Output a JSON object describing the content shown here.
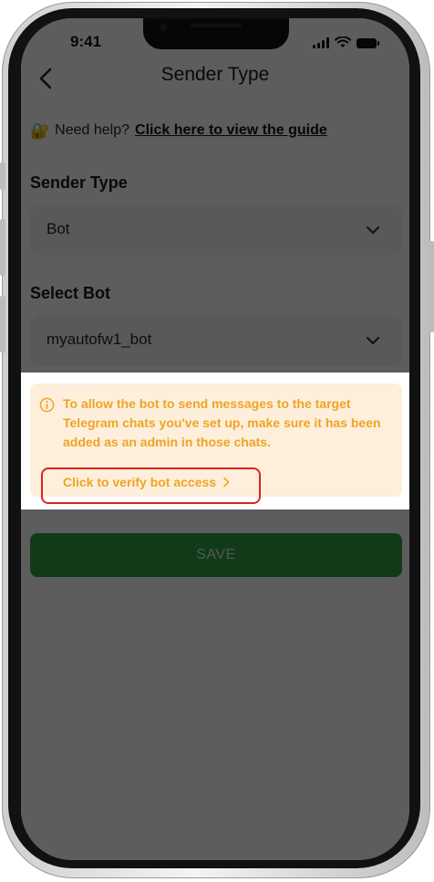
{
  "status_bar": {
    "time": "9:41"
  },
  "header": {
    "title": "Sender Type"
  },
  "help": {
    "prefix": "Need help?",
    "link": "Click here to view the guide",
    "icon": "lock-icon"
  },
  "form": {
    "sender_type": {
      "label": "Sender Type",
      "value": "Bot"
    },
    "select_bot": {
      "label": "Select Bot",
      "value": "myautofw1_bot"
    },
    "save_label": "SAVE"
  },
  "notice": {
    "text": "To allow the bot to send messages to the target Telegram chats you've set up, make sure it has been added as an admin in those chats.",
    "verify_label": "Click to verify bot access",
    "accent_color": "#f0a423"
  }
}
